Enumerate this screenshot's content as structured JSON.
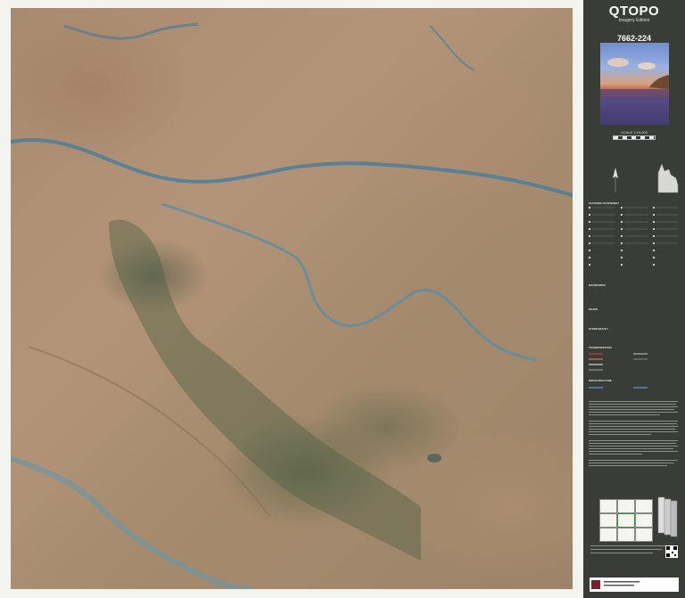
{
  "sidebar": {
    "brand": "QTOPO",
    "edition": "Imagery Edition",
    "sheet_number": "7662-224",
    "scale": "SCALE 1:15,000"
  },
  "colors": {
    "sidebar_bg": "#3a3d37",
    "river": "#4a7f9a",
    "vegetation": "#4f6248",
    "terrain": "#ab8c70"
  },
  "legend": {
    "headings": [
      "FEATURES OF INTEREST",
      "BOUNDARIES",
      "ROADS",
      "HYDROGRAPHY",
      "TRANSPORTATION",
      "INFRASTRUCTURE"
    ]
  },
  "icons": [
    "queensland-state-outline-icon",
    "north-arrow-icon",
    "qr-code-icon"
  ]
}
